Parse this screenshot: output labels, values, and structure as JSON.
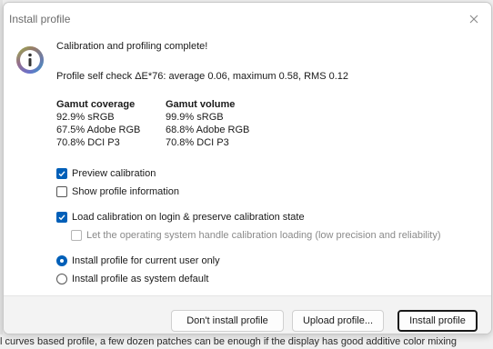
{
  "window": {
    "title": "Install profile"
  },
  "message": {
    "heading": "Calibration and profiling complete!",
    "self_check": "Profile self check ΔE*76: average 0.06, maximum 0.58, RMS 0.12"
  },
  "gamut": {
    "coverage": {
      "header": "Gamut coverage",
      "rows": [
        "92.9% sRGB",
        "67.5% Adobe RGB",
        "70.8% DCI P3"
      ]
    },
    "volume": {
      "header": "Gamut volume",
      "rows": [
        "99.9% sRGB",
        "68.8% Adobe RGB",
        "70.8% DCI P3"
      ]
    }
  },
  "options": {
    "preview_calibration": {
      "label": "Preview calibration",
      "checked": true
    },
    "show_profile_info": {
      "label": "Show profile information",
      "checked": false
    },
    "load_calibration": {
      "label": "Load calibration on login & preserve calibration state",
      "checked": true
    },
    "os_handle_loading": {
      "label": "Let the operating system handle calibration loading (low precision and reliability)",
      "checked": false,
      "enabled": false
    }
  },
  "install_scope": {
    "current_user": {
      "label": "Install profile for current user only",
      "selected": true
    },
    "system_default": {
      "label": "Install profile as system default",
      "selected": false
    }
  },
  "buttons": {
    "dont_install": "Don't install profile",
    "upload": "Upload profile...",
    "install": "Install profile"
  },
  "background": {
    "text": "l curves based profile, a few dozen patches can be enough if the display has good additive color mixing"
  },
  "colors": {
    "accent": "#005fb8"
  }
}
